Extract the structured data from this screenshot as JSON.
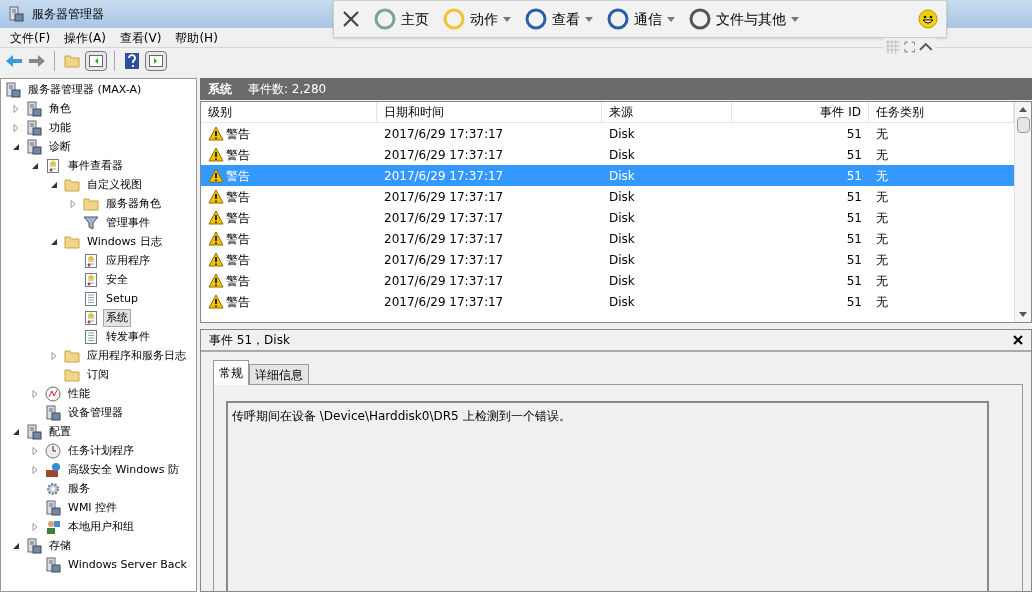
{
  "window": {
    "title": "服务器管理器"
  },
  "menu": [
    "文件(F)",
    "操作(A)",
    "查看(V)",
    "帮助(H)"
  ],
  "quick_bar": {
    "items": [
      {
        "label": "主页",
        "has_menu": false
      },
      {
        "label": "动作",
        "has_menu": true
      },
      {
        "label": "查看",
        "has_menu": true
      },
      {
        "label": "通信",
        "has_menu": true
      },
      {
        "label": "文件与其他",
        "has_menu": true
      }
    ]
  },
  "tree": [
    {
      "label": "服务器管理器 (MAX-A)",
      "selected": false,
      "children": [
        {
          "label": "角色",
          "expanded": false,
          "selected": false
        },
        {
          "label": "功能",
          "expanded": false,
          "selected": false
        },
        {
          "label": "诊断",
          "expanded": true,
          "selected": false,
          "children": [
            {
              "label": "事件查看器",
              "expanded": true,
              "selected": false,
              "children": [
                {
                  "label": "自定义视图",
                  "expanded": true,
                  "selected": false,
                  "children": [
                    {
                      "label": "服务器角色",
                      "expanded": false,
                      "selected": false
                    },
                    {
                      "label": "管理事件",
                      "selected": false
                    }
                  ]
                },
                {
                  "label": "Windows 日志",
                  "expanded": true,
                  "selected": false,
                  "children": [
                    {
                      "label": "应用程序",
                      "selected": false
                    },
                    {
                      "label": "安全",
                      "selected": false
                    },
                    {
                      "label": "Setup",
                      "selected": false
                    },
                    {
                      "label": "系统",
                      "selected": true
                    },
                    {
                      "label": "转发事件",
                      "selected": false
                    }
                  ]
                },
                {
                  "label": "应用程序和服务日志",
                  "expanded": false,
                  "selected": false
                },
                {
                  "label": "订阅",
                  "selected": false
                }
              ]
            },
            {
              "label": "性能",
              "expanded": false,
              "selected": false
            },
            {
              "label": "设备管理器",
              "selected": false
            }
          ]
        },
        {
          "label": "配置",
          "expanded": true,
          "selected": false,
          "children": [
            {
              "label": "任务计划程序",
              "expanded": false,
              "selected": false
            },
            {
              "label": "高级安全 Windows 防",
              "expanded": false,
              "selected": false
            },
            {
              "label": "服务",
              "selected": false
            },
            {
              "label": "WMI 控件",
              "selected": false
            },
            {
              "label": "本地用户和组",
              "expanded": false,
              "selected": false
            }
          ]
        },
        {
          "label": "存储",
          "expanded": true,
          "selected": false,
          "children": [
            {
              "label": "Windows Server Back",
              "selected": false
            }
          ]
        }
      ]
    }
  ],
  "log_header": {
    "name": "系统",
    "count": "事件数: 2,280"
  },
  "table": {
    "columns": [
      "级别",
      "日期和时间",
      "来源",
      "事件 ID",
      "任务类别"
    ],
    "rows": [
      {
        "level": "警告",
        "time": "2017/6/29 17:37:17",
        "source": "Disk",
        "id": "51",
        "category": "无",
        "selected": false
      },
      {
        "level": "警告",
        "time": "2017/6/29 17:37:17",
        "source": "Disk",
        "id": "51",
        "category": "无",
        "selected": false
      },
      {
        "level": "警告",
        "time": "2017/6/29 17:37:17",
        "source": "Disk",
        "id": "51",
        "category": "无",
        "selected": true
      },
      {
        "level": "警告",
        "time": "2017/6/29 17:37:17",
        "source": "Disk",
        "id": "51",
        "category": "无",
        "selected": false
      },
      {
        "level": "警告",
        "time": "2017/6/29 17:37:17",
        "source": "Disk",
        "id": "51",
        "category": "无",
        "selected": false
      },
      {
        "level": "警告",
        "time": "2017/6/29 17:37:17",
        "source": "Disk",
        "id": "51",
        "category": "无",
        "selected": false
      },
      {
        "level": "警告",
        "time": "2017/6/29 17:37:17",
        "source": "Disk",
        "id": "51",
        "category": "无",
        "selected": false
      },
      {
        "level": "警告",
        "time": "2017/6/29 17:37:17",
        "source": "Disk",
        "id": "51",
        "category": "无",
        "selected": false
      },
      {
        "level": "警告",
        "time": "2017/6/29 17:37:17",
        "source": "Disk",
        "id": "51",
        "category": "无",
        "selected": false
      }
    ]
  },
  "detail": {
    "title": "事件 51，Disk",
    "tabs": [
      {
        "label": "常规",
        "selected": true
      },
      {
        "label": "详细信息",
        "selected": false
      }
    ],
    "message": "传呼期间在设备 \\Device\\Harddisk0\\DR5 上检测到一个错误。"
  }
}
